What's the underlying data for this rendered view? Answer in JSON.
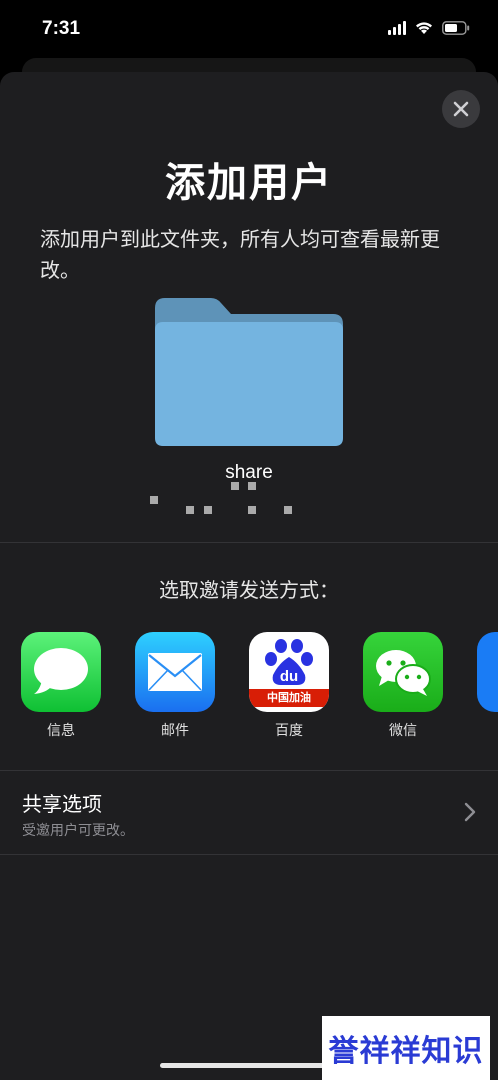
{
  "status_bar": {
    "time": "7:31"
  },
  "sheet": {
    "title": "添加用户",
    "subtitle": "添加用户到此文件夹，所有人均可查看最新更改。",
    "folder_name": "share",
    "share_prompt": "选取邀请发送方式："
  },
  "apps": [
    {
      "label": "信息",
      "icon": "messages-icon",
      "color": "#34c759"
    },
    {
      "label": "邮件",
      "icon": "mail-icon",
      "color": "#1a8cff"
    },
    {
      "label": "百度",
      "icon": "baidu-icon",
      "color": "#ffffff",
      "badge": "中国加油"
    },
    {
      "label": "微信",
      "icon": "wechat-icon",
      "color": "#2dc100"
    }
  ],
  "share_options": {
    "title": "共享选项",
    "subtitle": "受邀用户可更改。"
  },
  "watermark": "誉祥祥知识",
  "colors": {
    "sheet_bg": "#1e1e20",
    "folder_blue": "#74b4e0"
  }
}
